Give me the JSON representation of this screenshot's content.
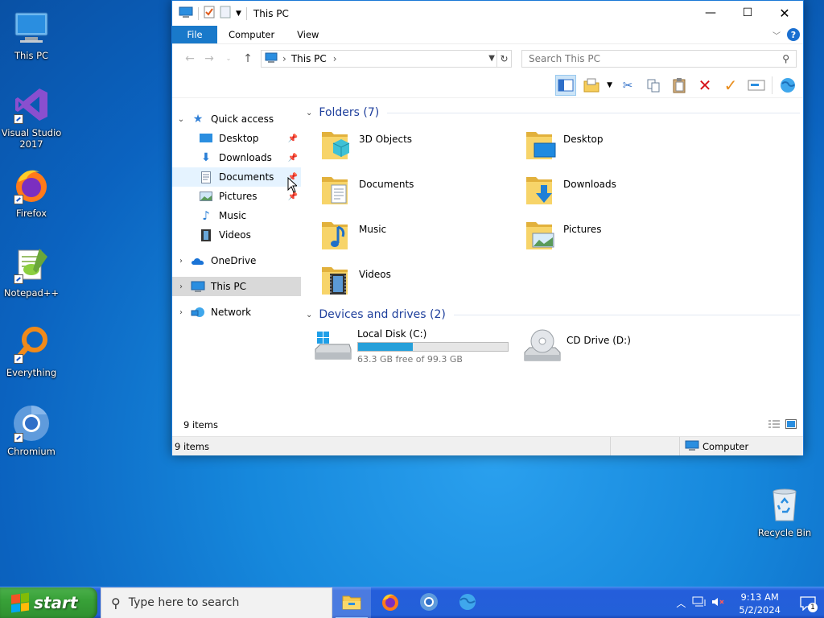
{
  "desktop": {
    "icons": [
      {
        "label": "This PC",
        "icon": "this-pc-icon"
      },
      {
        "label": "Visual Studio 2017",
        "icon": "visual-studio-icon"
      },
      {
        "label": "Firefox",
        "icon": "firefox-icon"
      },
      {
        "label": "Notepad++",
        "icon": "notepadpp-icon"
      },
      {
        "label": "Everything",
        "icon": "everything-icon"
      },
      {
        "label": "Chromium",
        "icon": "chromium-icon"
      },
      {
        "label": "Recycle Bin",
        "icon": "recycle-bin-icon"
      }
    ]
  },
  "window": {
    "title": "This PC",
    "ribbon_tabs": {
      "file": "File",
      "computer": "Computer",
      "view": "View"
    },
    "address": {
      "location": "This PC"
    },
    "search": {
      "placeholder": "Search This PC"
    },
    "nav": {
      "quick_access": "Quick access",
      "quick_items": [
        {
          "label": "Desktop",
          "icon": "desktop-folder-icon"
        },
        {
          "label": "Downloads",
          "icon": "downloads-folder-icon"
        },
        {
          "label": "Documents",
          "icon": "documents-folder-icon"
        },
        {
          "label": "Pictures",
          "icon": "pictures-folder-icon"
        },
        {
          "label": "Music",
          "icon": "music-folder-icon"
        },
        {
          "label": "Videos",
          "icon": "videos-folder-icon"
        }
      ],
      "onedrive": "OneDrive",
      "this_pc": "This PC",
      "network": "Network"
    },
    "content": {
      "folders_header": "Folders (7)",
      "folders": [
        {
          "name": "3D Objects",
          "icon": "3d-objects-folder-icon"
        },
        {
          "name": "Desktop",
          "icon": "desktop-folder-icon"
        },
        {
          "name": "Documents",
          "icon": "documents-folder-icon"
        },
        {
          "name": "Downloads",
          "icon": "downloads-folder-icon"
        },
        {
          "name": "Music",
          "icon": "music-folder-icon"
        },
        {
          "name": "Pictures",
          "icon": "pictures-folder-icon"
        },
        {
          "name": "Videos",
          "icon": "videos-folder-icon"
        }
      ],
      "drives_header": "Devices and drives (2)",
      "drives": [
        {
          "name": "Local Disk (C:)",
          "free_text": "63.3 GB free of 99.3 GB",
          "used_fraction": 0.363
        },
        {
          "name": "CD Drive (D:)"
        }
      ]
    },
    "item_count": "9 items",
    "status": {
      "left": "9 items",
      "right": "Computer"
    }
  },
  "taskbar": {
    "start_label": "start",
    "search_placeholder": "Type here to search",
    "apps": [
      "file-explorer-icon",
      "firefox-icon",
      "chromium-icon",
      "browser-globe-icon"
    ],
    "time": "9:13 AM",
    "date": "5/2/2024",
    "notification_count": "1"
  },
  "colors": {
    "accent": "#1979ca",
    "group_header": "#1e3f9c",
    "drive_bar": "#26a0da",
    "start_green": "#38a138",
    "taskbar_blue": "#245edb"
  }
}
